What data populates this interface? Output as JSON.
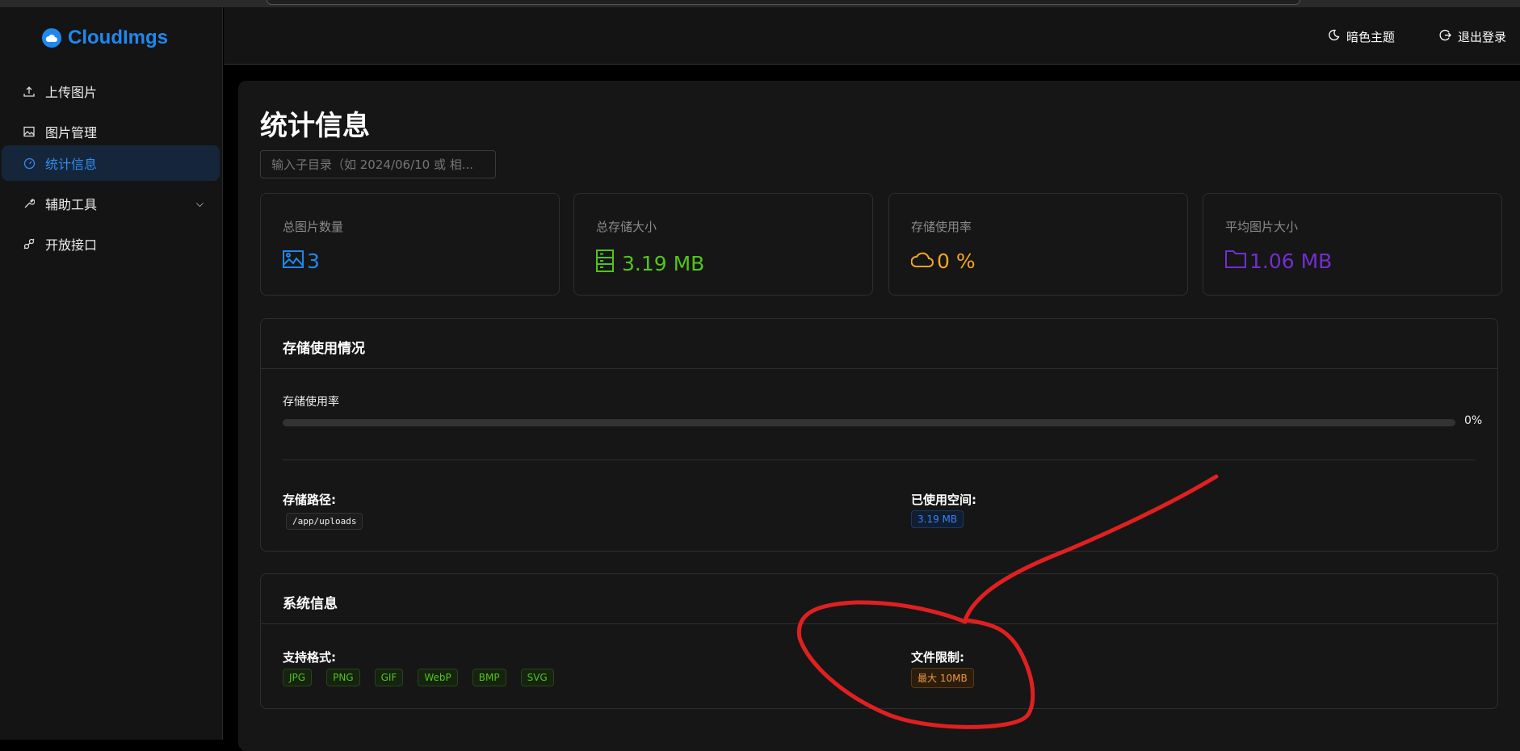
{
  "app": {
    "name": "CloudImgs"
  },
  "sidebar": {
    "items": [
      {
        "label": "上传图片",
        "icon": "upload-icon"
      },
      {
        "label": "图片管理",
        "icon": "image-icon"
      },
      {
        "label": "统计信息",
        "icon": "dashboard-icon",
        "active": true
      },
      {
        "label": "辅助工具",
        "icon": "wrench-icon",
        "expandable": true
      },
      {
        "label": "开放接口",
        "icon": "api-icon"
      }
    ]
  },
  "header": {
    "theme_label": "暗色主题",
    "logout_label": "退出登录"
  },
  "page": {
    "title": "统计信息",
    "search_placeholder": "输入子目录（如 2024/06/10 或 相..."
  },
  "stats": [
    {
      "label": "总图片数量",
      "value": "3",
      "color": "#1e88f0",
      "icon": "image-icon"
    },
    {
      "label": "总存储大小",
      "value": "3.19 MB",
      "color": "#52c41a",
      "icon": "server-icon"
    },
    {
      "label": "存储使用率",
      "value": "0 %",
      "color": "#f5a623",
      "icon": "cloud-icon"
    },
    {
      "label": "平均图片大小",
      "value": "1.06 MB",
      "color": "#722ed1",
      "icon": "folder-icon"
    }
  ],
  "storage": {
    "title": "存储使用情况",
    "usage_label": "存储使用率",
    "usage_percent": 0,
    "usage_text": "0%",
    "path_label": "存储路径:",
    "path": "/app/uploads",
    "used_label": "已使用空间:",
    "used": "3.19 MB"
  },
  "system": {
    "title": "系统信息",
    "formats_label": "支持格式:",
    "formats": [
      "JPG",
      "PNG",
      "GIF",
      "WebP",
      "BMP",
      "SVG"
    ],
    "limit_label": "文件限制:",
    "limit": "最大 10MB"
  }
}
